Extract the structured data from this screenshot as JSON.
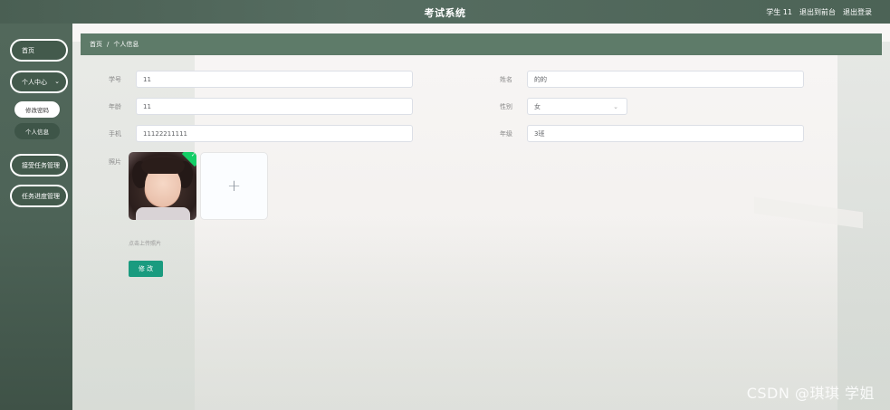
{
  "header": {
    "title": "考试系统",
    "user_label": "学生 11",
    "to_admin_label": "退出到前台",
    "logout_label": "退出登录"
  },
  "sidebar": {
    "items": [
      {
        "label": "首页"
      },
      {
        "label": "个人中心",
        "chevron": "chevron-down-icon"
      },
      {
        "label": "修改密码"
      },
      {
        "label": "个人信息"
      },
      {
        "label": "接受任务管理"
      },
      {
        "label": "任务进度管理"
      }
    ]
  },
  "breadcrumb": {
    "home": "首页",
    "separator": "/",
    "current": "个人信息"
  },
  "form": {
    "student_no": {
      "label": "学号",
      "value": "11"
    },
    "name": {
      "label": "姓名",
      "value": "的的"
    },
    "age": {
      "label": "年龄",
      "value": "11"
    },
    "gender": {
      "label": "性别",
      "value": "女"
    },
    "phone": {
      "label": "手机",
      "value": "11122211111"
    },
    "grade": {
      "label": "年级",
      "value": "3班"
    },
    "photo": {
      "label": "照片",
      "tip": "点击上传照片",
      "add_symbol": "+"
    },
    "submit_label": "修 改"
  },
  "watermark": "CSDN @琪琪 学姐"
}
